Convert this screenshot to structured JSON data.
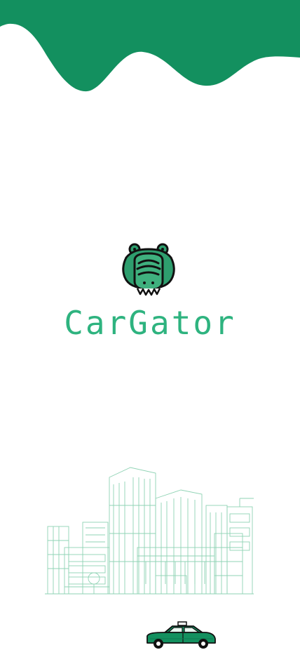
{
  "app": {
    "name": "CarGator"
  },
  "colors": {
    "brand": "#13905f",
    "brand_dark": "#0f7a50",
    "title": "#2eb37f",
    "logo_green": "#2e9e6e",
    "sketch": "#8fd3b4",
    "outline": "#111111"
  },
  "icons": {
    "logo": "alligator-head-icon",
    "city": "city-buildings-illustration",
    "taxi": "taxi-car-illustration"
  }
}
